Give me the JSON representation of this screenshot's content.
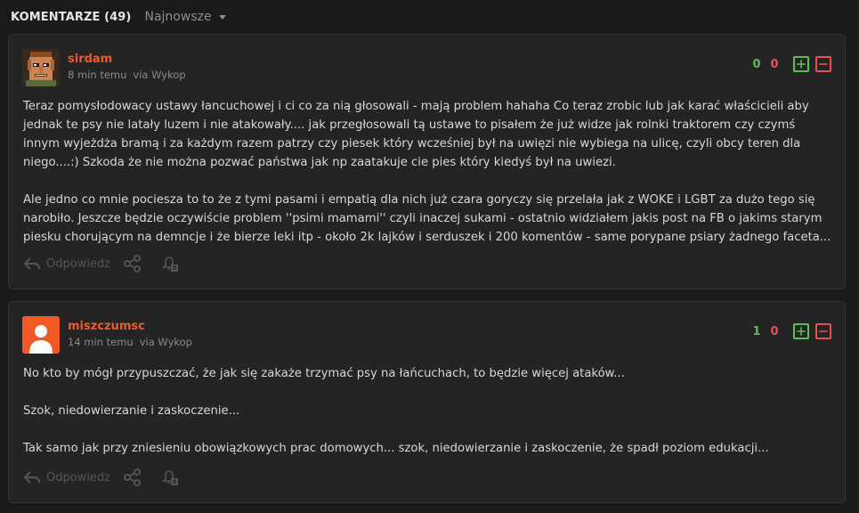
{
  "header": {
    "title": "KOMENTARZE (49)",
    "sort_label": "Najnowsze"
  },
  "colors": {
    "author": "#f15a24",
    "plus": "#5fbd55",
    "minus": "#e65151",
    "background": "#1a1a1b",
    "card": "#242425"
  },
  "comments": [
    {
      "author": "sirdam",
      "time": "8 min temu",
      "via": "via Wykop",
      "avatar_icon": "pixel-face-avatar",
      "plus": "0",
      "minus": "0",
      "paragraphs": [
        "Teraz pomysłodowacy ustawy łancuchowej i ci co za nią głosowali - mają problem hahaha Co teraz zrobic lub jak karać właścicieli aby jednak te psy nie latały luzem i nie atakowały.... jak przegłosowali tą ustawe to pisałem że już widze jak rolnki traktorem czy czymś innym wyjeżdża bramą i za każdym razem patrzy czy piesek który wcześniej był na uwięzi nie wybiega na ulicę, czyli obcy teren dla niego....:) Szkoda że nie można pozwać państwa jak np zaatakuje cie pies który kiedyś był na uwiezi.",
        "Ale jedno co mnie pociesza to to że z tymi pasami i empatią dla nich już czara goryczy się przelała jak z WOKE i LGBT za dużo tego się narobiło. Jeszcze będzie oczywiście problem ''psimi mamami'' czyli inaczej sukami - ostatnio widziałem jakis post na FB o jakims starym piesku chorującym na demncje i że bierze leki itp - około 2k lajków i serduszek i 200 komentów - same porypane psiary żadnego faceta..."
      ],
      "reply_label": "Odpowiedz"
    },
    {
      "author": "miszczumsc",
      "time": "14 min temu",
      "via": "via Wykop",
      "avatar_icon": "default-user-avatar",
      "plus": "1",
      "minus": "0",
      "paragraphs": [
        "No kto by mógł przypuszczać, że jak się zakaże trzymać psy na łańcuchach, to będzie więcej ataków...",
        "Szok, niedowierzanie i zaskoczenie...",
        "Tak samo jak przy zniesieniu obowiązkowych prac domowych... szok, niedowierzanie i zaskoczenie, że spadł poziom edukacji..."
      ],
      "reply_label": "Odpowiedz"
    }
  ]
}
